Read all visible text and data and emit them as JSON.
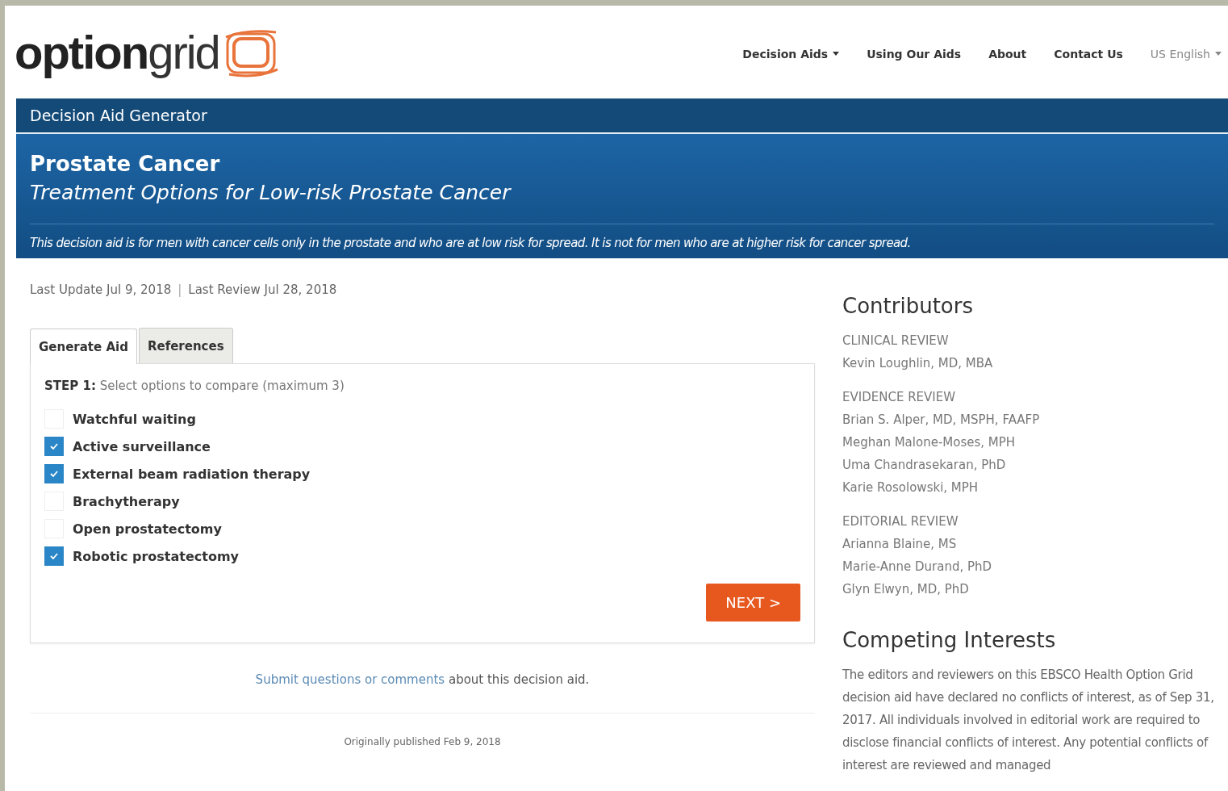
{
  "logo": {
    "bold": "option",
    "light": "grid"
  },
  "nav": [
    {
      "label": "Decision Aids",
      "kind": "menu"
    },
    {
      "label": "Using Our Aids",
      "kind": "link"
    },
    {
      "label": "About",
      "kind": "link"
    },
    {
      "label": "Contact Us",
      "kind": "link"
    },
    {
      "label": "US English",
      "kind": "language"
    }
  ],
  "section_bar": {
    "title": "Decision Aid Generator"
  },
  "banner": {
    "title": "Prostate Cancer",
    "subtitle": "Treatment Options for Low-risk Prostate Cancer",
    "note": "This decision aid is for men with cancer cells only in the prostate and who are at low risk for spread. It is not for men who are at higher risk for cancer spread."
  },
  "dates": {
    "updated": "Last Update Jul 9, 2018",
    "separator": "|",
    "reviewed": "Last Review Jul 28, 2018"
  },
  "tabs": [
    {
      "label": "Generate Aid",
      "selected": true
    },
    {
      "label": "References",
      "selected": false
    }
  ],
  "step": {
    "label": "STEP 1:",
    "text": "Select options to compare (maximum 3)"
  },
  "options": [
    {
      "label": "Watchful waiting",
      "checked": false
    },
    {
      "label": "Active surveillance",
      "checked": true
    },
    {
      "label": "External beam radiation therapy",
      "checked": true
    },
    {
      "label": "Brachytherapy",
      "checked": false
    },
    {
      "label": "Open prostatectomy",
      "checked": false
    },
    {
      "label": "Robotic prostatectomy",
      "checked": true
    }
  ],
  "next_button": "NEXT >",
  "feedback": {
    "link": "Submit questions or comments",
    "text": "about this decision aid."
  },
  "published": "Originally published Feb 9, 2018",
  "contributors": {
    "title": "Contributors",
    "groups": [
      {
        "heading": "CLINICAL REVIEW",
        "names": [
          "Kevin Loughlin, MD, MBA"
        ]
      },
      {
        "heading": "EVIDENCE REVIEW",
        "names": [
          "Brian S. Alper, MD, MSPH, FAAFP",
          "Meghan Malone-Moses, MPH",
          "Uma Chandrasekaran, PhD",
          "Karie Rosolowski, MPH"
        ]
      },
      {
        "heading": "EDITORIAL REVIEW",
        "names": [
          "Arianna Blaine, MS",
          "Marie-Anne Durand, PhD",
          "Glyn Elwyn, MD, PhD"
        ]
      }
    ]
  },
  "competing_interests": {
    "title": "Competing Interests",
    "text": "The editors and reviewers on this EBSCO Health Option Grid decision aid have declared no conflicts of interest, as of Sep 31, 2017. All individuals involved in editorial work are required to disclose financial conflicts of interest. Any potential conflicts of interest are reviewed and managed"
  }
}
